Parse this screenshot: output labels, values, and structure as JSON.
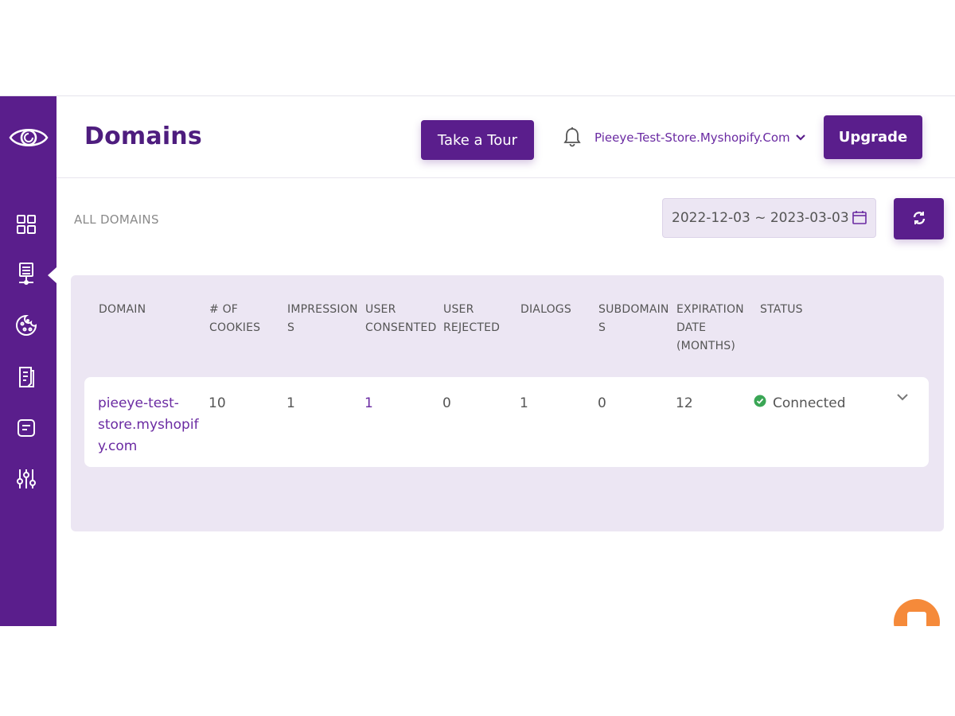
{
  "header": {
    "title": "Domains",
    "tour_label": "Take a Tour",
    "store_name": "Pieeye-Test-Store.Myshopify.Com",
    "upgrade_label": "Upgrade"
  },
  "section": {
    "label": "ALL DOMAINS",
    "date_range": "2022-12-03 ~ 2023-03-03"
  },
  "sidebar": {
    "items": [
      {
        "icon": "dashboard-grid-icon"
      },
      {
        "icon": "domains-server-icon",
        "active": true
      },
      {
        "icon": "cookie-icon"
      },
      {
        "icon": "policy-document-icon"
      },
      {
        "icon": "notes-icon"
      },
      {
        "icon": "settings-sliders-icon"
      }
    ]
  },
  "table": {
    "headers": {
      "domain": "DOMAIN",
      "cookies": [
        "# OF",
        "COOKIES"
      ],
      "impressions": [
        "IMPRESSION",
        "S"
      ],
      "consented": [
        "USER",
        "CONSENTED"
      ],
      "rejected": [
        "USER",
        "REJECTED"
      ],
      "dialogs": "DIALOGS",
      "subdomains": [
        "SUBDOMAIN",
        "S"
      ],
      "expiration": [
        "EXPIRATION",
        "DATE",
        "(MONTHS)"
      ],
      "status": "STATUS"
    },
    "rows": [
      {
        "domain": [
          "pieeye-test-",
          "store.myshopif",
          "y.com"
        ],
        "cookies": "10",
        "impressions": "1",
        "consented": "1",
        "rejected": "0",
        "dialogs": "1",
        "subdomains": "0",
        "expiration": "12",
        "status": "Connected"
      }
    ]
  },
  "colors": {
    "brand": "#5a1e8c",
    "status_ok": "#3aa655",
    "chat": "#f58a3a"
  }
}
